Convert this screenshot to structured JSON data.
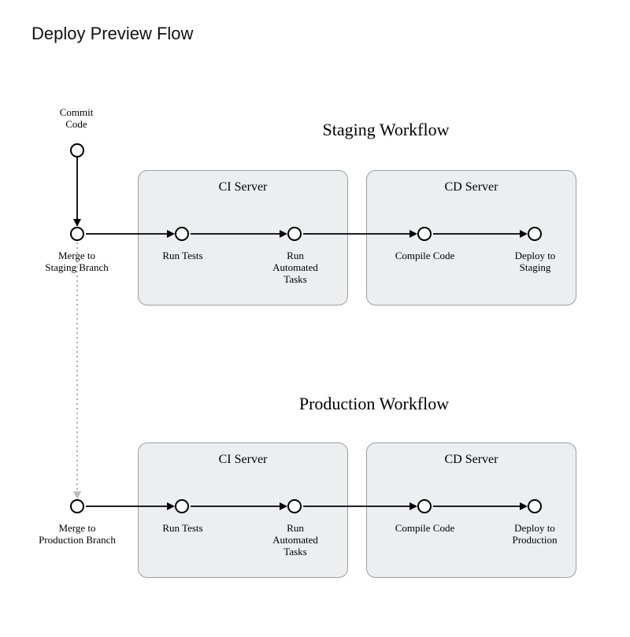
{
  "title": "Deploy Preview Flow",
  "staging": {
    "title": "Staging Workflow",
    "ci_box": "CI Server",
    "cd_box": "CD Server",
    "commit": "Commit\nCode",
    "merge": "Merge to\nStaging Branch",
    "run_tests": "Run Tests",
    "run_tasks": "Run\nAutomated\nTasks",
    "compile": "Compile Code",
    "deploy": "Deploy to\nStaging"
  },
  "production": {
    "title": "Production Workflow",
    "ci_box": "CI Server",
    "cd_box": "CD Server",
    "merge": "Merge to\nProduction Branch",
    "run_tests": "Run Tests",
    "run_tasks": "Run\nAutomated\nTasks",
    "compile": "Compile Code",
    "deploy": "Deploy to\nProduction"
  }
}
